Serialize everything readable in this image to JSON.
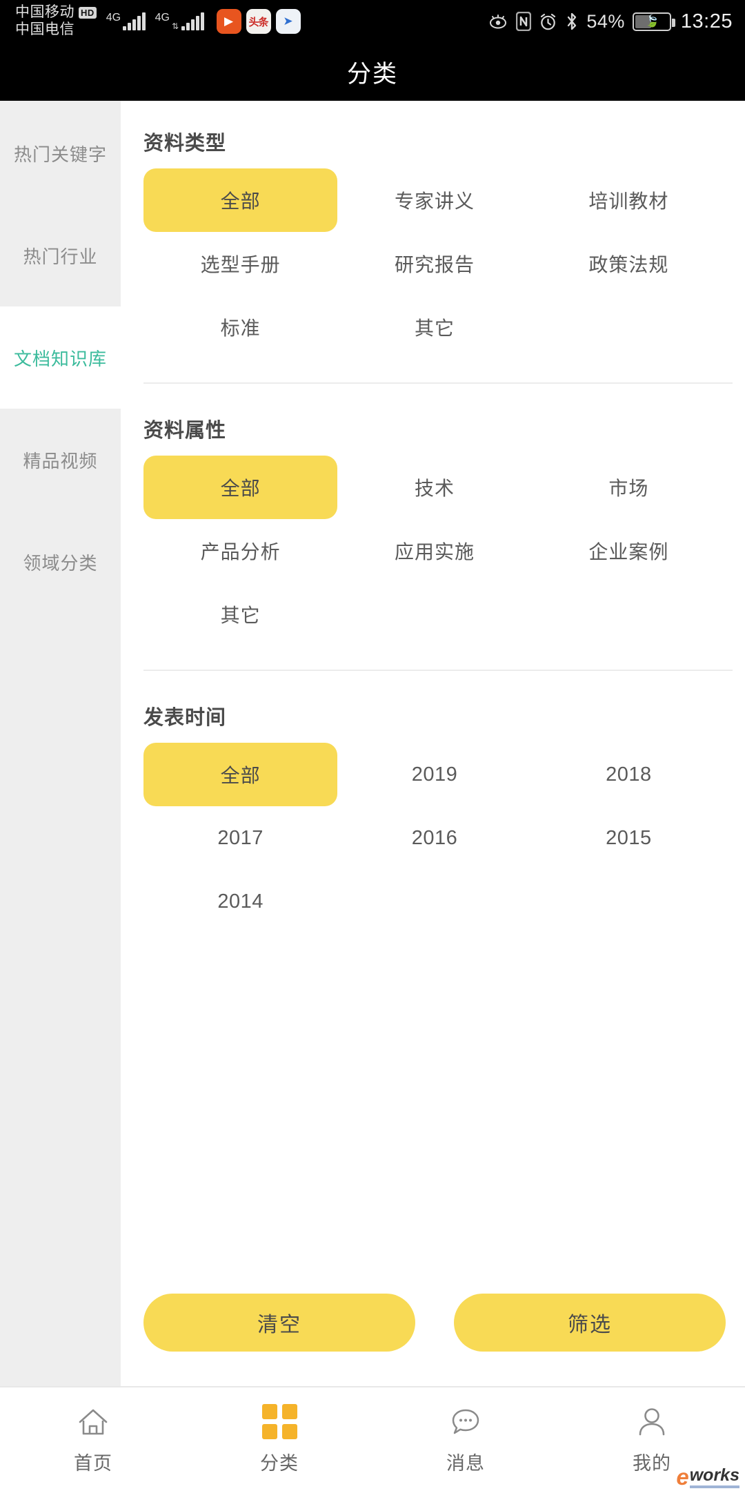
{
  "status_bar": {
    "carrier_primary": "中国移动",
    "carrier_primary_badge": "HD",
    "carrier_secondary": "中国电信",
    "network_1": "4G",
    "network_2": "4G",
    "app_icon_1": "video-player-icon",
    "app_icon_2": "头条",
    "app_icon_3": "share-icon",
    "eye_comfort_icon": "eye-icon",
    "nfc_icon": "N",
    "alarm_icon": "alarm-icon",
    "bluetooth_icon": "bluetooth-icon",
    "battery_percent": "54%",
    "battery_saver_icon": "leaf-icon",
    "time": "13:25"
  },
  "header": {
    "title": "分类"
  },
  "sidebar": {
    "items": [
      {
        "label": "热门关键字",
        "active": false
      },
      {
        "label": "热门行业",
        "active": false
      },
      {
        "label": "文档知识库",
        "active": true
      },
      {
        "label": "精品视频",
        "active": false
      },
      {
        "label": "领域分类",
        "active": false
      }
    ]
  },
  "filter_sections": [
    {
      "title": "资料类型",
      "options": [
        {
          "label": "全部",
          "selected": true
        },
        {
          "label": "专家讲义",
          "selected": false
        },
        {
          "label": "培训教材",
          "selected": false
        },
        {
          "label": "选型手册",
          "selected": false
        },
        {
          "label": "研究报告",
          "selected": false
        },
        {
          "label": "政策法规",
          "selected": false
        },
        {
          "label": "标准",
          "selected": false
        },
        {
          "label": "其它",
          "selected": false
        }
      ]
    },
    {
      "title": "资料属性",
      "options": [
        {
          "label": "全部",
          "selected": true
        },
        {
          "label": "技术",
          "selected": false
        },
        {
          "label": "市场",
          "selected": false
        },
        {
          "label": "产品分析",
          "selected": false
        },
        {
          "label": "应用实施",
          "selected": false
        },
        {
          "label": "企业案例",
          "selected": false
        },
        {
          "label": "其它",
          "selected": false
        }
      ]
    },
    {
      "title": "发表时间",
      "options": [
        {
          "label": "全部",
          "selected": true
        },
        {
          "label": "2019",
          "selected": false
        },
        {
          "label": "2018",
          "selected": false
        },
        {
          "label": "2017",
          "selected": false
        },
        {
          "label": "2016",
          "selected": false
        },
        {
          "label": "2015",
          "selected": false
        },
        {
          "label": "2014",
          "selected": false
        }
      ]
    }
  ],
  "actions": {
    "clear_label": "清空",
    "filter_label": "筛选"
  },
  "bottom_nav": {
    "items": [
      {
        "label": "首页",
        "icon": "home-icon",
        "active": false
      },
      {
        "label": "分类",
        "icon": "grid-icon",
        "active": true
      },
      {
        "label": "消息",
        "icon": "chat-bubble-icon",
        "active": false
      },
      {
        "label": "我的",
        "icon": "person-icon",
        "active": false
      }
    ]
  },
  "watermark": {
    "prefix": "e",
    "suffix": "works"
  },
  "colors": {
    "accent_yellow": "#F8DA55",
    "nav_active_yellow": "#F5B32A",
    "sidebar_active_teal": "#3BBB9C",
    "sidebar_bg": "#EEEEEE",
    "header_bg": "#000000"
  }
}
